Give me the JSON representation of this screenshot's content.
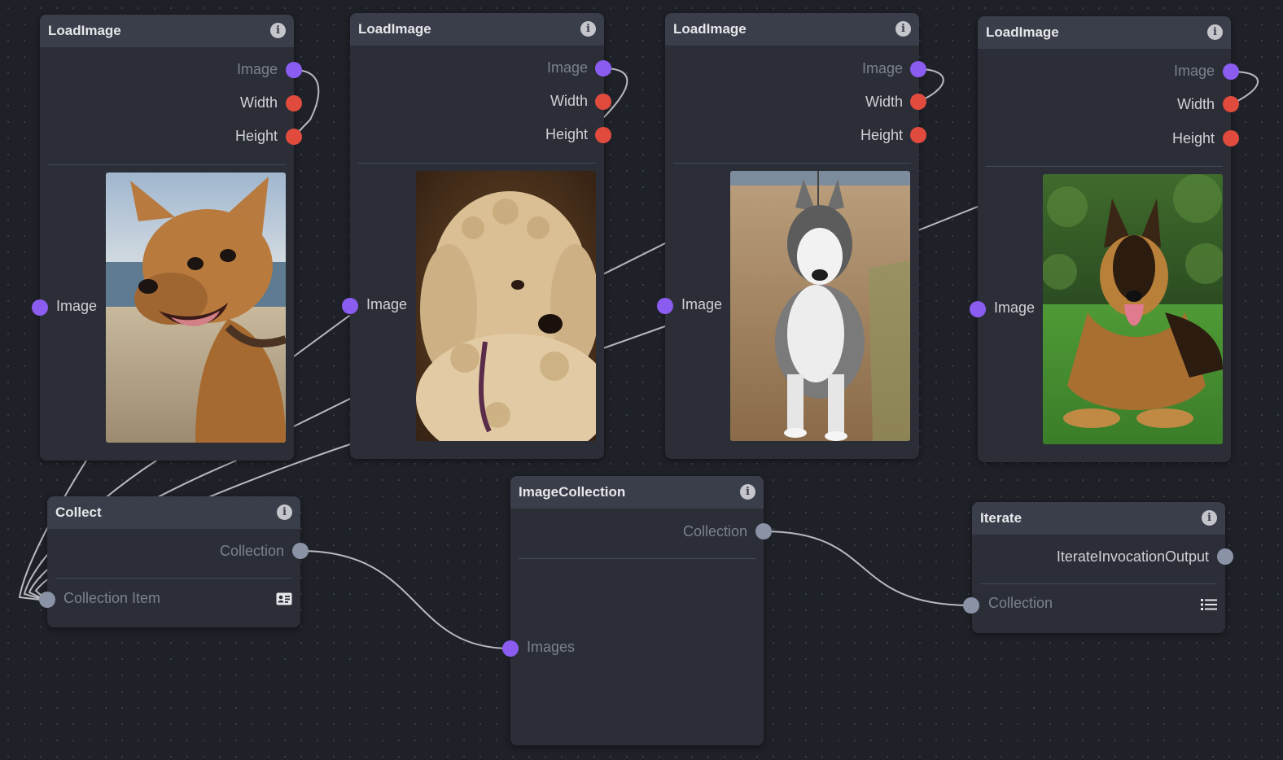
{
  "canvas": {
    "background": "#1f2128",
    "dot_color": "#3a3e4a"
  },
  "colors": {
    "image_handle": "#8a5cf0",
    "number_handle": "#e04b3e",
    "collection_handle": "#8a93a6",
    "wire": "#c9cbd0"
  },
  "load_image_nodes": [
    {
      "title": "LoadImage",
      "outputs": [
        "Image",
        "Width",
        "Height"
      ],
      "input": "Image",
      "thumbnail": "chihuahua on a sandy beach"
    },
    {
      "title": "LoadImage",
      "outputs": [
        "Image",
        "Width",
        "Height"
      ],
      "input": "Image",
      "thumbnail": "curly cream puppy"
    },
    {
      "title": "LoadImage",
      "outputs": [
        "Image",
        "Width",
        "Height"
      ],
      "input": "Image",
      "thumbnail": "husky on a dirt path"
    },
    {
      "title": "LoadImage",
      "outputs": [
        "Image",
        "Width",
        "Height"
      ],
      "input": "Image",
      "thumbnail": "german shepherd lying on grass"
    }
  ],
  "collect_node": {
    "title": "Collect",
    "output": "Collection",
    "input": "Collection Item",
    "input_icon": "id-card-icon"
  },
  "image_collection_node": {
    "title": "ImageCollection",
    "output": "Collection",
    "input": "Images"
  },
  "iterate_node": {
    "title": "Iterate",
    "output": "IterateInvocationOutput",
    "input": "Collection",
    "input_icon": "list-icon"
  },
  "icons": {
    "info": "info-icon"
  }
}
